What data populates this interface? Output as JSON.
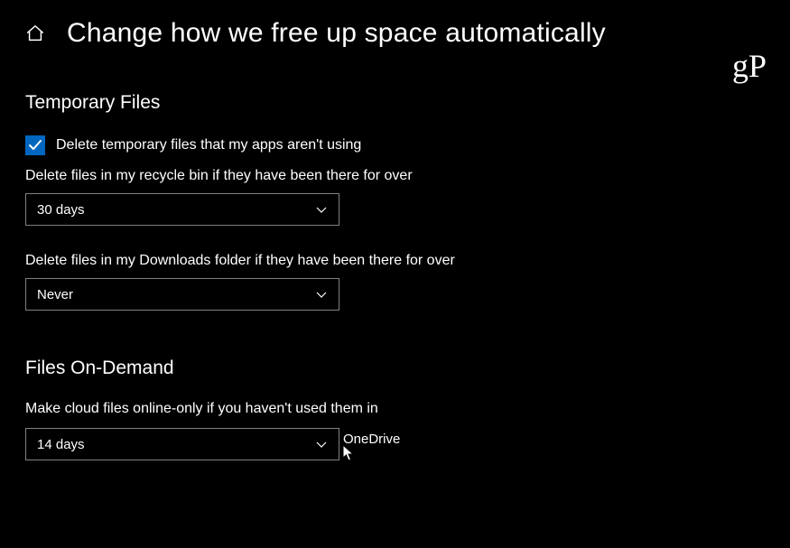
{
  "header": {
    "title": "Change how we free up space automatically"
  },
  "watermark": "gP",
  "sections": {
    "temp": {
      "heading": "Temporary Files",
      "checkbox_label": "Delete temporary files that my apps aren't using",
      "recycle_label": "Delete files in my recycle bin if they have been there for over",
      "recycle_value": "30 days",
      "downloads_label": "Delete files in my Downloads folder if they have been there for over",
      "downloads_value": "Never"
    },
    "fod": {
      "heading": "Files On-Demand",
      "cloud_label": "Make cloud files online-only if you haven't used them in",
      "cloud_value": "14 days",
      "cloud_suffix": "OneDrive"
    }
  }
}
